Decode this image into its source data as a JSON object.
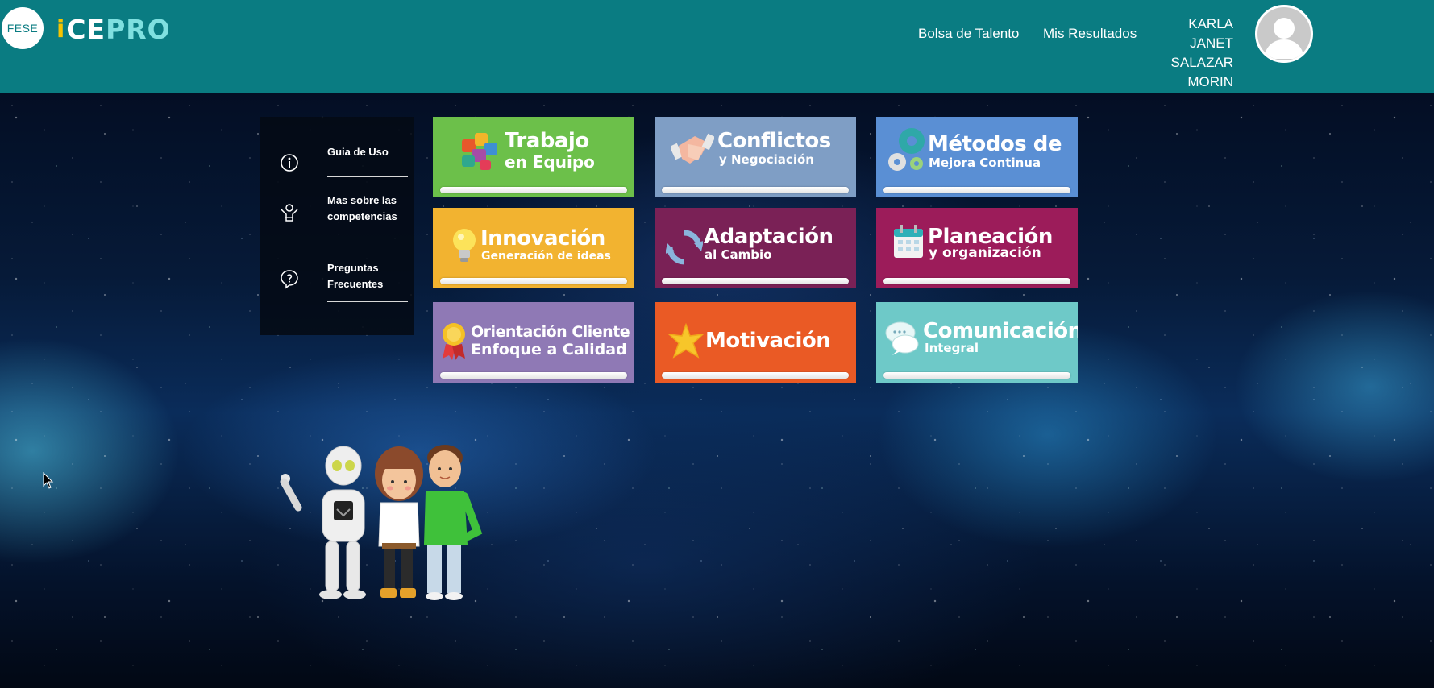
{
  "header": {
    "fese_logo": "FESE",
    "brand_i": "i",
    "brand_ce": "CE",
    "brand_pro": "PRO",
    "nav": [
      {
        "label": "Bolsa de Talento"
      },
      {
        "label": "Mis Resultados"
      }
    ],
    "user": {
      "name_lines": [
        "KARLA",
        "JANET",
        "SALAZAR",
        "MORIN"
      ]
    }
  },
  "side_menu": {
    "items": [
      {
        "label": "Guia de Uso",
        "icon": "info-icon"
      },
      {
        "label": "Mas sobre las competencias",
        "icon": "person-icon"
      },
      {
        "label": "Preguntas Frecuentes",
        "icon": "question-icon"
      }
    ]
  },
  "tiles": [
    {
      "title": "Trabajo",
      "subtitle": "en Equipo",
      "color": "#6cc04a",
      "icon": "puzzle-icon"
    },
    {
      "title": "Conflictos",
      "subtitle": "y Negociación",
      "color": "#7f9ec5",
      "icon": "handshake-icon"
    },
    {
      "title": "Métodos de",
      "subtitle": "Mejora Continua",
      "color": "#5a8fd4",
      "icon": "gears-icon"
    },
    {
      "title": "Innovación",
      "subtitle": "Generación de ideas",
      "color": "#f2b330",
      "icon": "lightbulb-icon"
    },
    {
      "title": "Adaptación",
      "subtitle": "al Cambio",
      "color": "#7a2156",
      "icon": "refresh-icon"
    },
    {
      "title": "Planeación",
      "subtitle": "y organización",
      "color": "#9c1c5a",
      "icon": "calendar-icon"
    },
    {
      "title": "Orientación Cliente",
      "subtitle": "Enfoque a Calidad",
      "color": "#8f79b5",
      "icon": "medal-icon"
    },
    {
      "title": "Motivación",
      "subtitle": "",
      "color": "#ea5a25",
      "icon": "star-icon"
    },
    {
      "title": "Comunicación",
      "subtitle": "Integral",
      "color": "#6ec9c8",
      "icon": "chat-bubble-icon"
    }
  ]
}
